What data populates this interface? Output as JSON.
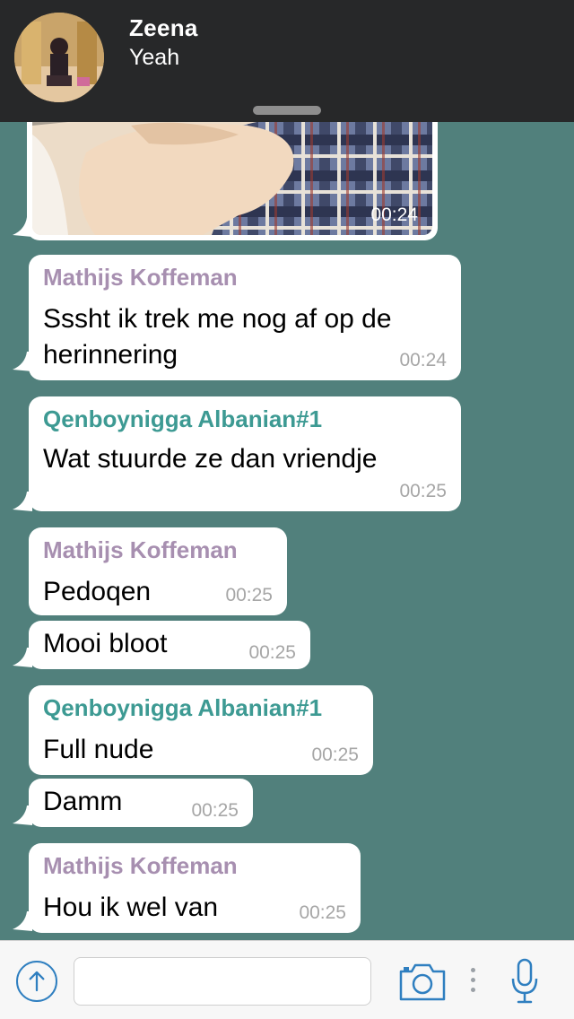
{
  "notification": {
    "contact_name": "Zeena",
    "preview": "Yeah"
  },
  "image_message": {
    "time": "00:24"
  },
  "messages": [
    {
      "sender": "Mathijs Koffeman",
      "text": "Sssht ik trek me nog af op de herinnering",
      "time": "00:24"
    },
    {
      "sender": "Qenboynigga Albanian#1",
      "text": "Wat stuurde ze dan vriendje",
      "time": "00:25"
    },
    {
      "sender": "Mathijs Koffeman",
      "text": "Pedoqen",
      "time": "00:25"
    },
    {
      "sender": "",
      "text": "Mooi bloot",
      "time": "00:25"
    },
    {
      "sender": "Qenboynigga Albanian#1",
      "text": "Full nude",
      "time": "00:25"
    },
    {
      "sender": "",
      "text": "Damm",
      "time": "00:25"
    },
    {
      "sender": "Mathijs Koffeman",
      "text": "Hou ik wel van",
      "time": "00:25"
    }
  ],
  "input_bar": {
    "placeholder": "",
    "icons": [
      "attach-upload-icon",
      "camera-icon",
      "more-vertical-icon",
      "microphone-icon"
    ]
  },
  "colors": {
    "chat_background": "#51807c",
    "header_background": "#272829",
    "sender_purple": "#a78fb0",
    "sender_teal": "#3d9a93",
    "accent_blue": "#2f7fc0"
  }
}
